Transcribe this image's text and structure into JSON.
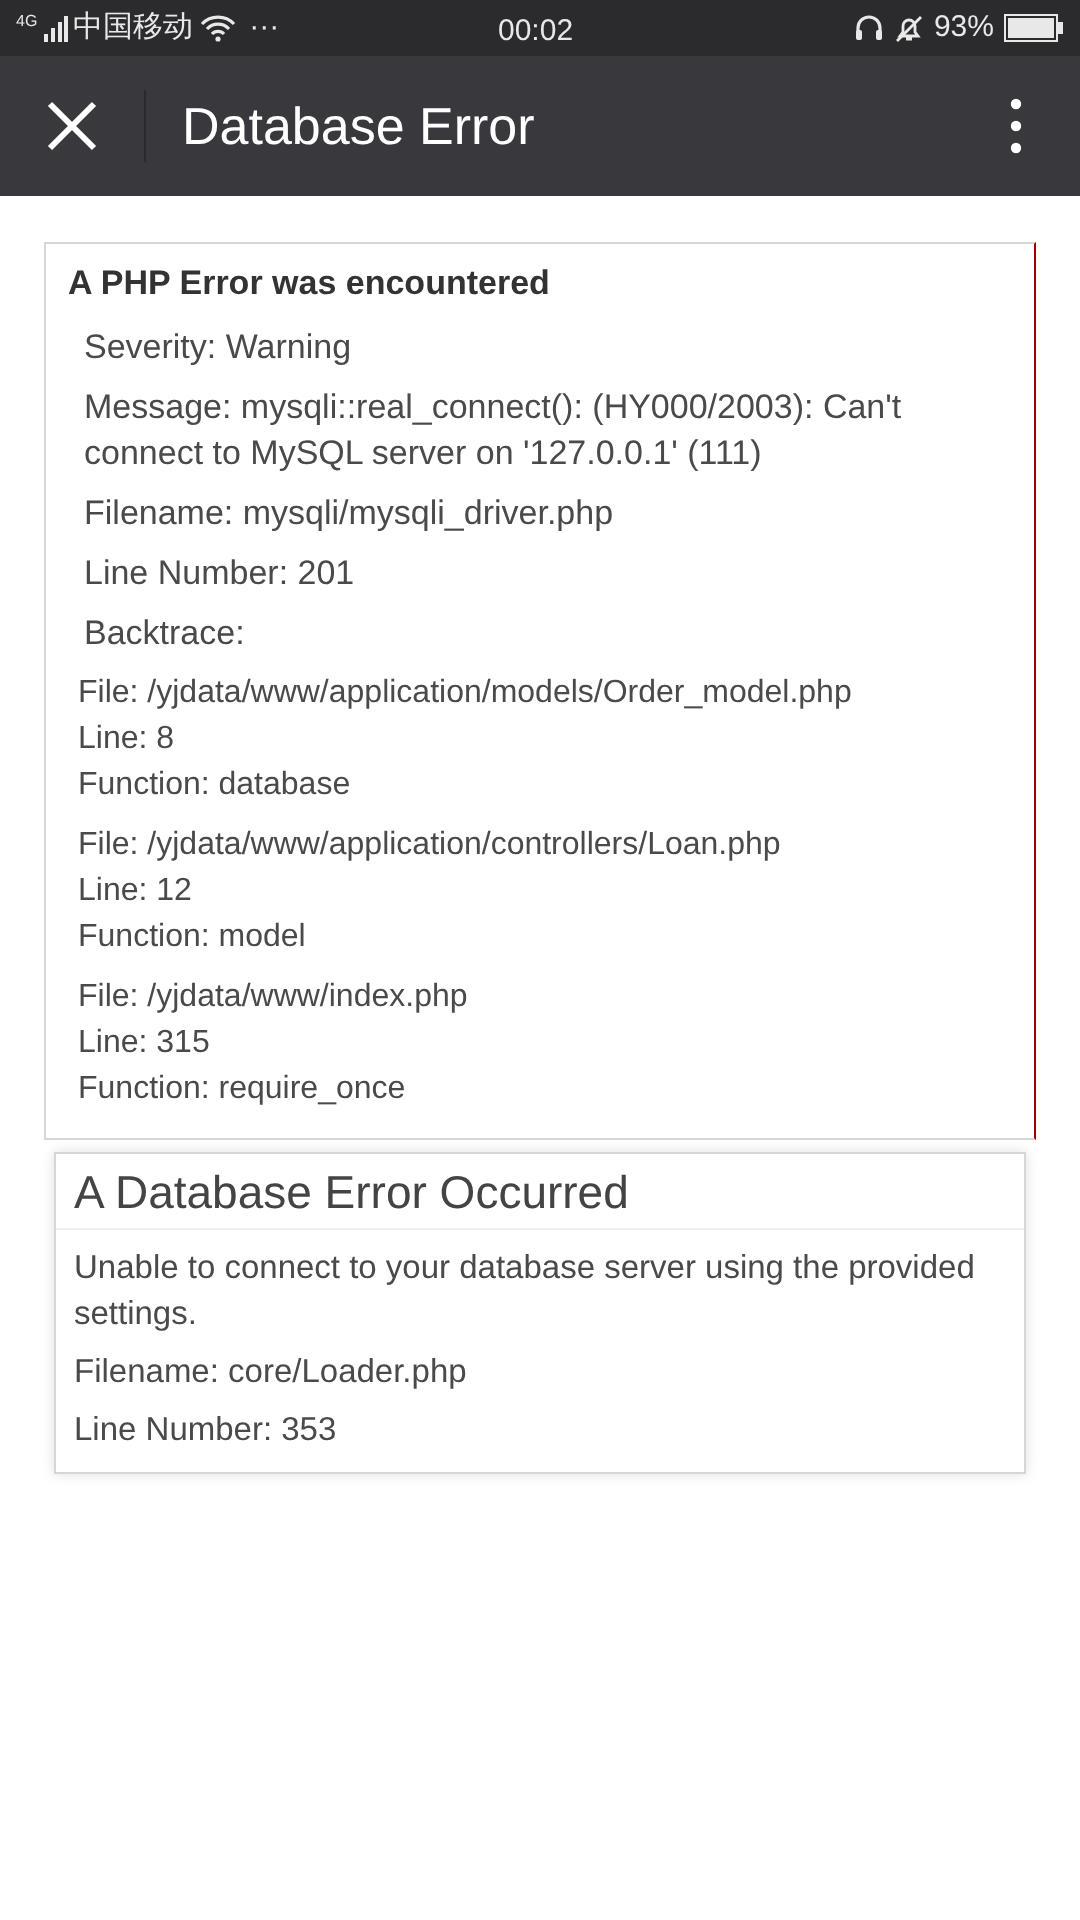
{
  "status_bar": {
    "network": "4G",
    "carrier": "中国移动",
    "more": "···",
    "time": "00:02",
    "battery": "93%"
  },
  "toolbar": {
    "title": "Database Error"
  },
  "php_error": {
    "heading": "A PHP Error was encountered",
    "details": [
      "Severity: Warning",
      "Message: mysqli::real_connect(): (HY000/2003): Can't connect to MySQL server on '127.0.0.1' (111)",
      "Filename: mysqli/mysqli_driver.php",
      "Line Number: 201",
      "Backtrace:"
    ],
    "backtrace": [
      {
        "lines": [
          "File: /yjdata/www/application/models/Order_model.php",
          "Line: 8",
          "Function: database"
        ]
      },
      {
        "lines": [
          "File: /yjdata/www/application/controllers/Loan.php",
          "Line: 12",
          "Function: model"
        ]
      },
      {
        "lines": [
          "File: /yjdata/www/index.php",
          "Line: 315",
          "Function: require_once"
        ]
      }
    ]
  },
  "database_error": {
    "heading": "A Database Error Occurred",
    "paragraphs": [
      "Unable to connect to your database server using the provided settings.",
      "Filename: core/Loader.php",
      "Line Number: 353"
    ]
  }
}
